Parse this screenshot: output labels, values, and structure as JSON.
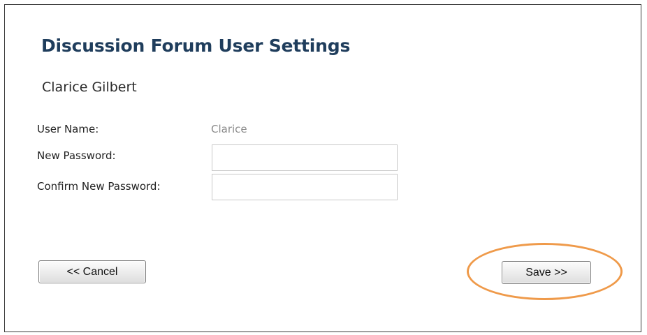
{
  "page": {
    "title": "Discussion Forum User Settings",
    "display_name": "Clarice Gilbert"
  },
  "form": {
    "user_name_label": "User Name:",
    "user_name_value": "Clarice",
    "new_password_label": "New Password:",
    "new_password_value": "",
    "confirm_password_label": "Confirm New Password:",
    "confirm_password_value": ""
  },
  "buttons": {
    "cancel_label": "<< Cancel",
    "save_label": "Save >>"
  },
  "highlight": {
    "target": "save-button",
    "color": "#ef9a4a"
  }
}
